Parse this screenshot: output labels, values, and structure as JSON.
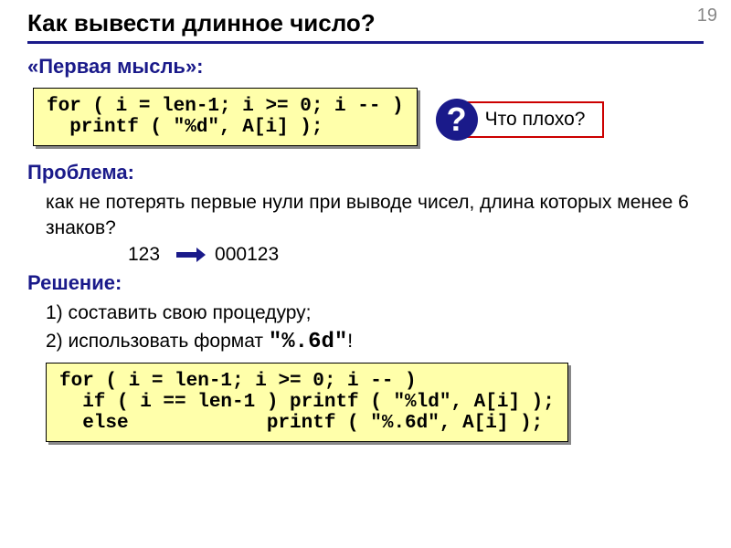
{
  "page_number": "19",
  "title": "Как вывести длинное число?",
  "first_thought": {
    "label": "«Первая мысль»:",
    "code": "for ( i = len-1; i >= 0; i -- )\n  printf ( \"%d\", A[i] );",
    "callout_mark": "?",
    "callout_text": "Что плохо?"
  },
  "problem": {
    "label": "Проблема:",
    "text": "как не потерять первые нули при выводе чисел, длина которых менее 6 знаков?",
    "example_left": "123",
    "example_right": "000123"
  },
  "solution": {
    "label": "Решение:",
    "item1": "1) составить свою процедуру;",
    "item2_prefix": "2) использовать формат ",
    "item2_format": "\"%.6d\"",
    "item2_suffix": "!",
    "code": "for ( i = len-1; i >= 0; i -- )\n  if ( i == len-1 ) printf ( \"%ld\", A[i] );\n  else            printf ( \"%.6d\", A[i] );"
  }
}
